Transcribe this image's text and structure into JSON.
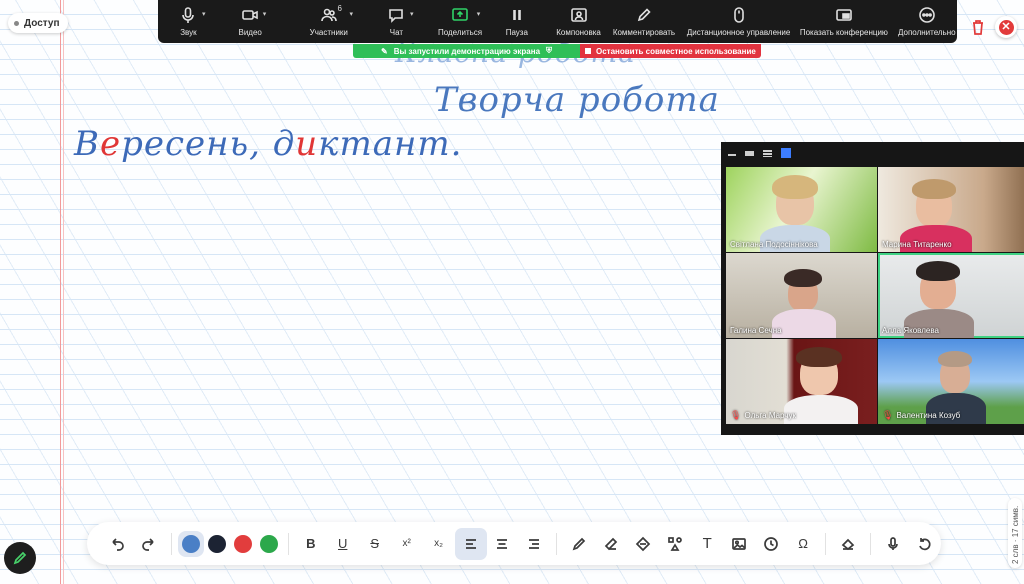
{
  "access_label": "Доступ",
  "toolbar": [
    {
      "id": "sound",
      "label": "Звук",
      "icon": "microphone-icon",
      "caret": true
    },
    {
      "id": "video",
      "label": "Видео",
      "icon": "video-camera-icon",
      "caret": true
    },
    {
      "id": "participants",
      "label": "Участники",
      "icon": "participants-icon",
      "caret": true,
      "count": "6"
    },
    {
      "id": "chat",
      "label": "Чат",
      "icon": "chat-icon",
      "caret": true
    },
    {
      "id": "share",
      "label": "Поделиться",
      "icon": "share-screen-icon",
      "caret": true
    },
    {
      "id": "pause",
      "label": "Пауза",
      "icon": "pause-icon"
    },
    {
      "id": "layout",
      "label": "Компоновка",
      "icon": "layout-icon"
    },
    {
      "id": "comment",
      "label": "Комментировать",
      "icon": "pencil-icon"
    },
    {
      "id": "remote",
      "label": "Дистанционное управление",
      "icon": "mouse-icon"
    },
    {
      "id": "show",
      "label": "Показать конференцию",
      "icon": "show-meeting-icon"
    },
    {
      "id": "more",
      "label": "Дополнительно",
      "icon": "more-icon"
    }
  ],
  "share_banner": {
    "sharing_text": "Вы запустили демонстрацию экрана",
    "stop_text": "Остановить совместное использование"
  },
  "handwriting": {
    "top_partial": "Класна робота",
    "title": "Творча робота",
    "line1_a": "В",
    "line1_b": "е",
    "line1_c": "ресень, д",
    "line1_d": "и",
    "line1_e": "ктант."
  },
  "gallery": {
    "participants": [
      {
        "name": "Світлана Подосіннікова",
        "muted": false
      },
      {
        "name": "Марина Титаренко",
        "muted": false
      },
      {
        "name": "Галина Сечна",
        "muted": false
      },
      {
        "name": "Алла Яковлева",
        "muted": false
      },
      {
        "name": "Ольга Марчук",
        "muted": true
      },
      {
        "name": "Валентина Козуб",
        "muted": true
      }
    ]
  },
  "format_bar": {
    "colors": [
      "#4a7fc6",
      "#1c2333",
      "#e23d3d",
      "#2ca84b"
    ],
    "bold": "B",
    "underline": "U",
    "strike": "S",
    "superscript": "x²",
    "subscript": "x₂",
    "text_tool": "T",
    "omega": "Ω"
  },
  "slide_counter": "2 слв · 17 симв."
}
